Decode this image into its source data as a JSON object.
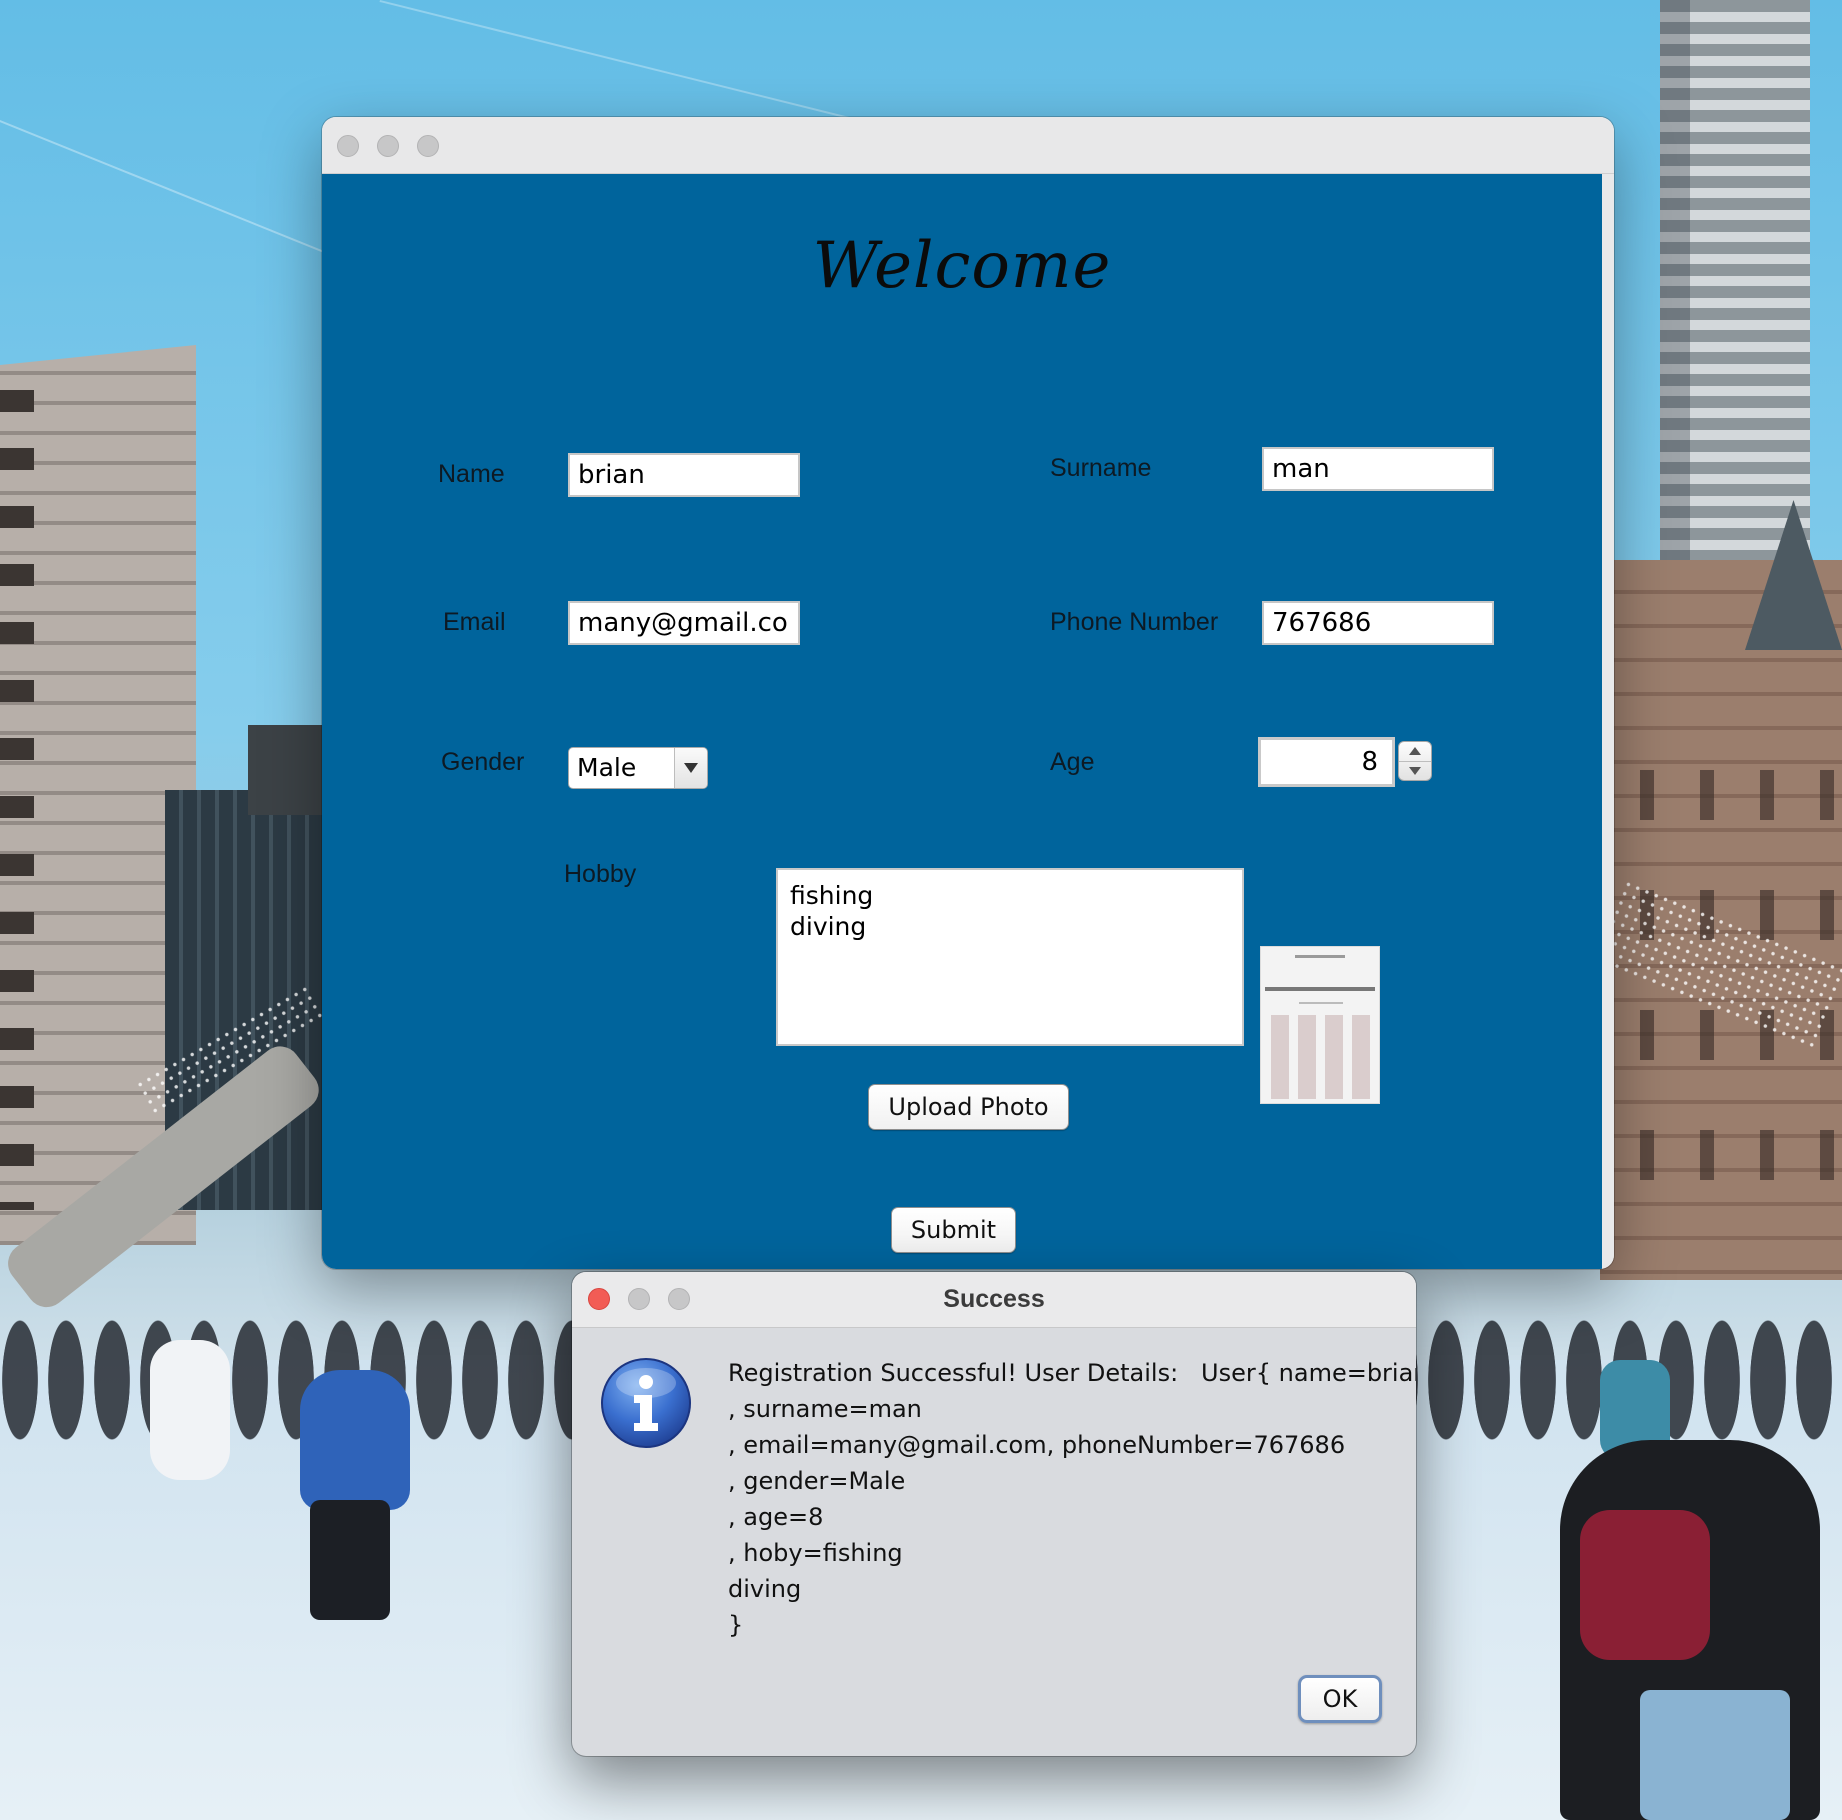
{
  "main_window": {
    "title": "Welcome",
    "form": {
      "name_label": "Name",
      "name_value": "brian",
      "surname_label": "Surname",
      "surname_value": "man",
      "email_label": "Email",
      "email_value": "many@gmail.com",
      "phone_label": "Phone Number",
      "phone_value": "767686",
      "gender_label": "Gender",
      "gender_value": "Male",
      "age_label": "Age",
      "age_value": "8",
      "hobby_label": "Hobby",
      "hobby_value": "fishing\ndiving"
    },
    "upload_button_label": "Upload Photo",
    "submit_button_label": "Submit",
    "panel_color": "#00649c"
  },
  "dialog": {
    "title": "Success",
    "message": "Registration Successful! User Details:   User{ name=brian\n, surname=man\n, email=many@gmail.com, phoneNumber=767686\n, gender=Male\n, age=8\n, hoby=fishing\ndiving\n}",
    "ok_label": "OK",
    "icon": "info-icon"
  },
  "photo_preview": {
    "icon": "photo-thumbnail"
  }
}
